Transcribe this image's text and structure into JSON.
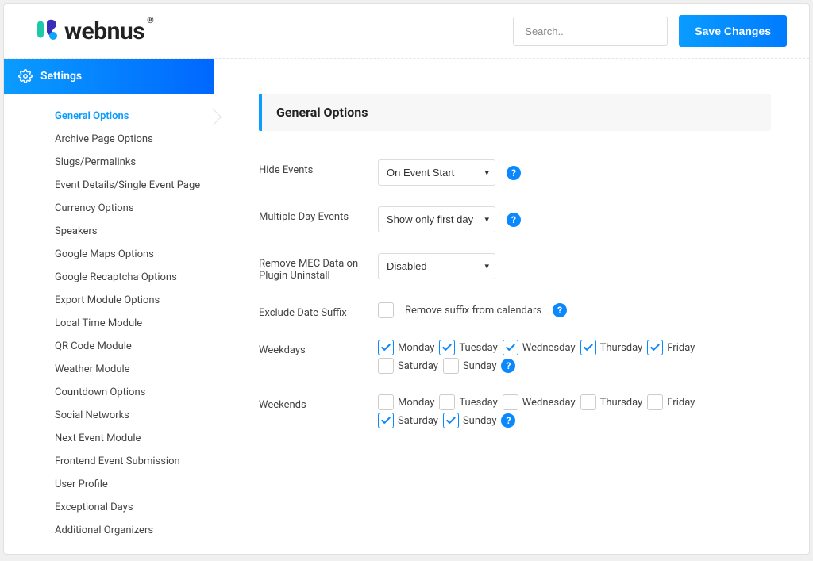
{
  "header": {
    "brand": "webnus",
    "search_placeholder": "Search..",
    "save_label": "Save Changes"
  },
  "sidebar": {
    "title": "Settings",
    "items": [
      "General Options",
      "Archive Page Options",
      "Slugs/Permalinks",
      "Event Details/Single Event Page",
      "Currency Options",
      "Speakers",
      "Google Maps Options",
      "Google Recaptcha Options",
      "Export Module Options",
      "Local Time Module",
      "QR Code Module",
      "Weather Module",
      "Countdown Options",
      "Social Networks",
      "Next Event Module",
      "Frontend Event Submission",
      "User Profile",
      "Exceptional Days",
      "Additional Organizers"
    ],
    "active_index": 0
  },
  "main": {
    "section_title": "General Options",
    "hide_events": {
      "label": "Hide Events",
      "value": "On Event Start"
    },
    "multiple_day": {
      "label": "Multiple Day Events",
      "value": "Show only first day"
    },
    "remove_data": {
      "label": "Remove MEC Data on Plugin Uninstall",
      "value": "Disabled"
    },
    "exclude_suffix": {
      "label": "Exclude Date Suffix",
      "option": "Remove suffix from calendars",
      "checked": false
    },
    "weekdays": {
      "label": "Weekdays",
      "days": [
        {
          "name": "Monday",
          "checked": true
        },
        {
          "name": "Tuesday",
          "checked": true
        },
        {
          "name": "Wednesday",
          "checked": true
        },
        {
          "name": "Thursday",
          "checked": true
        },
        {
          "name": "Friday",
          "checked": true
        },
        {
          "name": "Saturday",
          "checked": false
        },
        {
          "name": "Sunday",
          "checked": false
        }
      ]
    },
    "weekends": {
      "label": "Weekends",
      "days": [
        {
          "name": "Monday",
          "checked": false
        },
        {
          "name": "Tuesday",
          "checked": false
        },
        {
          "name": "Wednesday",
          "checked": false
        },
        {
          "name": "Thursday",
          "checked": false
        },
        {
          "name": "Friday",
          "checked": false
        },
        {
          "name": "Saturday",
          "checked": true
        },
        {
          "name": "Sunday",
          "checked": true
        }
      ]
    },
    "help": "?"
  }
}
